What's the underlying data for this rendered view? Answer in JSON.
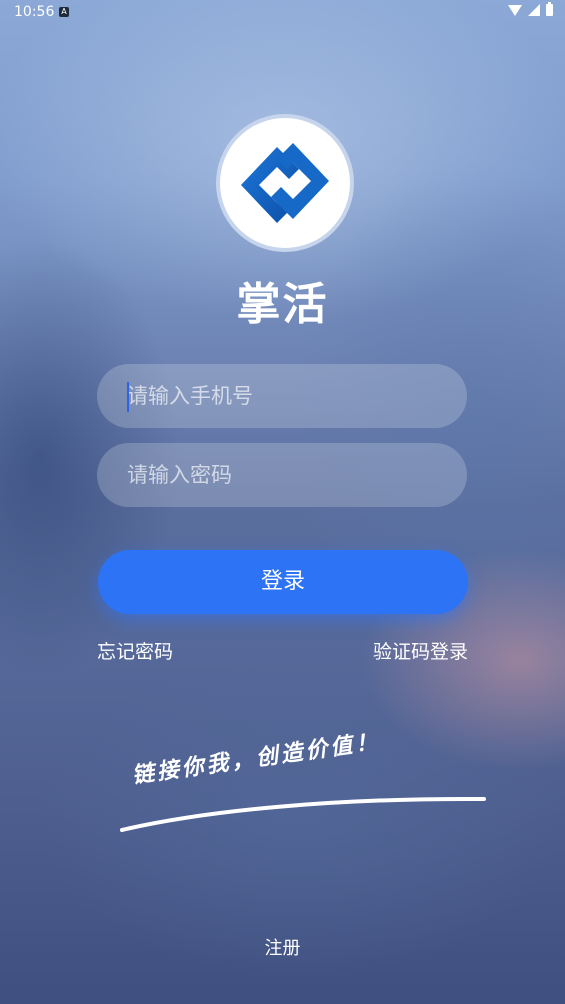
{
  "status_bar": {
    "time": "10:56",
    "notification_icon": "a-icon"
  },
  "app": {
    "title": "掌活",
    "logo_icon": "chain-link-icon",
    "brand_color": "#2d73f5"
  },
  "form": {
    "phone_placeholder": "请输入手机号",
    "phone_value": "",
    "password_placeholder": "请输入密码",
    "password_value": ""
  },
  "actions": {
    "login_label": "登录",
    "forgot_password_label": "忘记密码",
    "sms_login_label": "验证码登录",
    "register_label": "注册"
  },
  "slogan": "链接你我，创造价值！"
}
